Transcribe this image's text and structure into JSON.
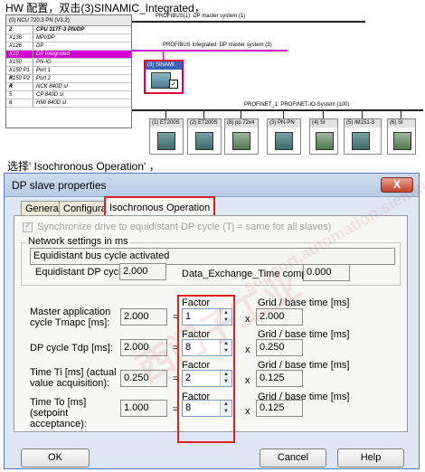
{
  "intro_caption": "HW 配置，双击(3)SINAMIC_Integrated，",
  "step_caption": "选择' Isochronous Operation' ，",
  "hw_config": {
    "rack_title": "(0) NCU 720.3 PN (V3.2)",
    "rack_rows": [
      {
        "slot": "2",
        "module": "CPU 317F-3 PN/DP"
      },
      {
        "slot": "X136",
        "module": "MPI/DP"
      },
      {
        "slot": "X126",
        "module": "DP"
      },
      {
        "slot": "X10",
        "module": "DP Integrated"
      },
      {
        "slot": "X150",
        "module": "PN-IO"
      },
      {
        "slot": "X150 P1 R",
        "module": "Port 1"
      },
      {
        "slot": "X150 P2 R",
        "module": "Port 2"
      },
      {
        "slot": "4",
        "module": "NCK 840D sl"
      },
      {
        "slot": "5",
        "module": "CP 840D sl"
      },
      {
        "slot": "6",
        "module": "HMI 840D sl"
      }
    ],
    "profibus1_label": "PROFIBUS(1): DP master system (1)",
    "profibus_int_label": "PROFIBUS Integrated: DP master system (3)",
    "sinamic_label": "(3) SINAMI",
    "profinet_label": "PROFINET_1: PROFINET-IO-System (100)",
    "pn_devices": [
      "(1) ET200S",
      "(2) ET200S",
      "(8) pp 72x4",
      "(3) PN-PN",
      "(4) SI",
      "(5) IM151-3",
      "(6) SI"
    ]
  },
  "dialog": {
    "title": "DP slave properties",
    "close_symbol": "X",
    "tabs": [
      "General",
      "Configuration",
      "Isochronous Operation"
    ],
    "sync_checkbox_label": "Synchronize drive to equidistant DP cycle (Tj = same for all slaves)",
    "network_group_label": "Network settings in ms",
    "equidistant_status": "Equidistant bus cycle activated",
    "equidistant_dp_cycle_label": "Equidistant DP cycle:",
    "equidistant_dp_cycle_value": "2.000",
    "data_exchange_label": "Data_Exchange_Time comp. Tdx:",
    "data_exchange_value": "0.000",
    "factor_header": "Factor",
    "grid_header": "Grid / base time [ms]",
    "rows": [
      {
        "label": "Master application cycle Tmapc [ms]:",
        "value": "2.000",
        "factor": "1",
        "grid": "2.000"
      },
      {
        "label": "DP cycle Tdp [ms]:",
        "value": "2.000",
        "factor": "8",
        "grid": "0.250"
      },
      {
        "label": "Time Ti [ms] (actual value acquisition):",
        "value": "0.250",
        "factor": "2",
        "grid": "0.125"
      },
      {
        "label": "Time To [ms] (setpoint acceptance):",
        "value": "1.000",
        "factor": "8",
        "grid": "0.125"
      }
    ],
    "eq_symbol": "=",
    "x_symbol": "x",
    "ok_label": "OK",
    "cancel_label": "Cancel",
    "help_label": "Help"
  },
  "watermarks": [
    "西门子工业",
    "support.automation.siemens.com.cn"
  ],
  "colors": {
    "highlight_red": "#e02020",
    "selected_slot": "#d400d4",
    "profibus_integrated": "#cc00cc"
  }
}
